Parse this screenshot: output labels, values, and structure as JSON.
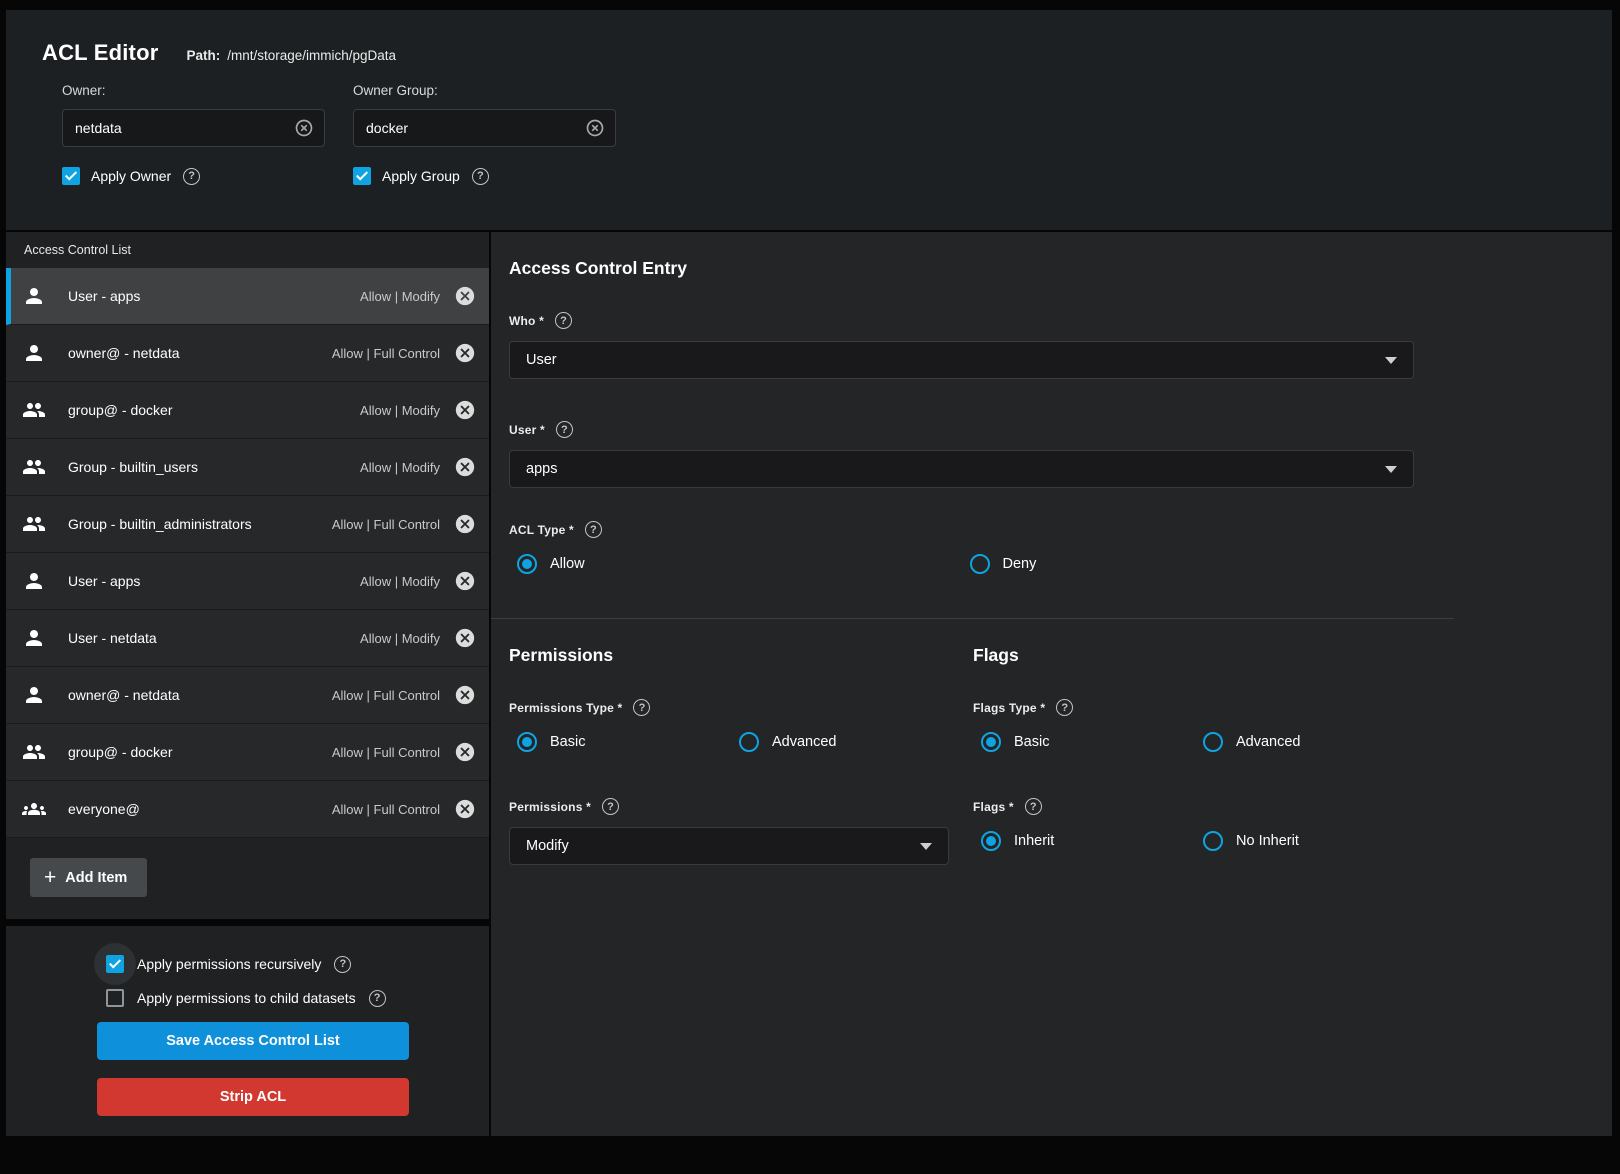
{
  "colors": {
    "accent": "#0fa3e2",
    "button": "#0e90da",
    "danger": "#d23730"
  },
  "header": {
    "title": "ACL Editor",
    "path_label": "Path:",
    "path_value": "/mnt/storage/immich/pgData",
    "owner": {
      "label": "Owner:",
      "value": "netdata",
      "apply_label": "Apply Owner",
      "apply_checked": true
    },
    "group": {
      "label": "Owner Group:",
      "value": "docker",
      "apply_label": "Apply Group",
      "apply_checked": true
    }
  },
  "acl_list": {
    "title": "Access Control List",
    "add_item_label": "Add Item",
    "items": [
      {
        "icon": "user",
        "name": "User - apps",
        "perms": "Allow | Modify",
        "selected": true
      },
      {
        "icon": "user",
        "name": "owner@ - netdata",
        "perms": "Allow | Full Control",
        "selected": false
      },
      {
        "icon": "group",
        "name": "group@ - docker",
        "perms": "Allow | Modify",
        "selected": false
      },
      {
        "icon": "group",
        "name": "Group - builtin_users",
        "perms": "Allow | Modify",
        "selected": false
      },
      {
        "icon": "group",
        "name": "Group - builtin_administrators",
        "perms": "Allow | Full Control",
        "selected": false
      },
      {
        "icon": "user",
        "name": "User - apps",
        "perms": "Allow | Modify",
        "selected": false
      },
      {
        "icon": "user",
        "name": "User - netdata",
        "perms": "Allow | Modify",
        "selected": false
      },
      {
        "icon": "user",
        "name": "owner@ - netdata",
        "perms": "Allow | Full Control",
        "selected": false
      },
      {
        "icon": "group",
        "name": "group@ - docker",
        "perms": "Allow | Full Control",
        "selected": false
      },
      {
        "icon": "everyone",
        "name": "everyone@",
        "perms": "Allow | Full Control",
        "selected": false
      }
    ]
  },
  "footer": {
    "recursive": {
      "label": "Apply permissions recursively",
      "checked": true
    },
    "child": {
      "label": "Apply permissions to child datasets",
      "checked": false
    },
    "save_label": "Save Access Control List",
    "strip_label": "Strip ACL"
  },
  "entry": {
    "title": "Access Control Entry",
    "who": {
      "label": "Who *",
      "value": "User"
    },
    "user": {
      "label": "User *",
      "value": "apps"
    },
    "acl_type": {
      "label": "ACL Type *",
      "options": [
        "Allow",
        "Deny"
      ],
      "selected": 0
    },
    "permissions": {
      "title": "Permissions",
      "type": {
        "label": "Permissions Type *",
        "options": [
          "Basic",
          "Advanced"
        ],
        "selected": 0
      },
      "perm": {
        "label": "Permissions *",
        "value": "Modify"
      }
    },
    "flags": {
      "title": "Flags",
      "type": {
        "label": "Flags Type *",
        "options": [
          "Basic",
          "Advanced"
        ],
        "selected": 0
      },
      "flags": {
        "label": "Flags *",
        "options": [
          "Inherit",
          "No Inherit"
        ],
        "selected": 0
      }
    }
  }
}
